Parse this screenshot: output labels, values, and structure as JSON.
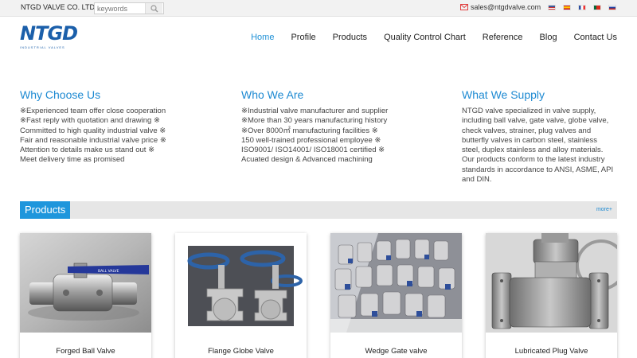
{
  "topbar": {
    "company": "NTGD VALVE CO. LTD",
    "search_placeholder": "keywords",
    "email": "sales@ntgdvalve.com",
    "flags": [
      "us-flag",
      "es-flag",
      "fr-flag",
      "pt-flag",
      "ru-flag"
    ]
  },
  "logo": {
    "text": "NTGD",
    "subtitle": "INDUSTRIAL VALVES"
  },
  "nav": {
    "items": [
      "Home",
      "Profile",
      "Products",
      "Quality Control Chart",
      "Reference",
      "Blog",
      "Contact Us"
    ],
    "active": "Home"
  },
  "columns": [
    {
      "title": "Why Choose Us",
      "text": "※Experienced team offer close cooperation\n※Fast reply with quotation and drawing ※\nCommitted to high quality industrial valve ※\nFair and reasonable industrial valve price ※\nAttention to details make us stand out ※\nMeet delivery time as promised"
    },
    {
      "title": "Who We Are",
      "text": "※Industrial valve manufacturer and supplier\n※More than 30 years manufacturing history\n※Over 8000㎡ manufacturing facilities ※\n150 well-trained professional employee ※\nISO9001/ ISO14001/ ISO18001 certified ※\nAcuated design & Advanced machining"
    },
    {
      "title": "What We Supply",
      "text": "NTGD valve specialized in valve supply,\nincluding ball valve, gate valve, globe valve,\ncheck valves, strainer, plug valves and\nbutterfly valves in carbon steel, stainless\nsteel, duplex stainless and alloy materials.\nOur products conform to the latest industry\nstandards in accordance to ANSI, ASME, API\nand DIN."
    }
  ],
  "products": {
    "title": "Products",
    "more": "more+",
    "items": [
      {
        "name": "Forged Ball Valve",
        "image": "forged-ball-valve-photo",
        "tag": "BALL VALVE"
      },
      {
        "name": "Flange Globe Valve",
        "image": "flange-globe-valve-photo"
      },
      {
        "name": "Wedge Gate valve",
        "image": "wedge-gate-valve-photo"
      },
      {
        "name": "Lubricated Plug Valve",
        "image": "lubricated-plug-valve-photo"
      }
    ]
  },
  "colors": {
    "accent": "#1e96dc",
    "heading": "#1e8ad2",
    "logo": "#1b5faa",
    "email_icon": "#e04040"
  }
}
